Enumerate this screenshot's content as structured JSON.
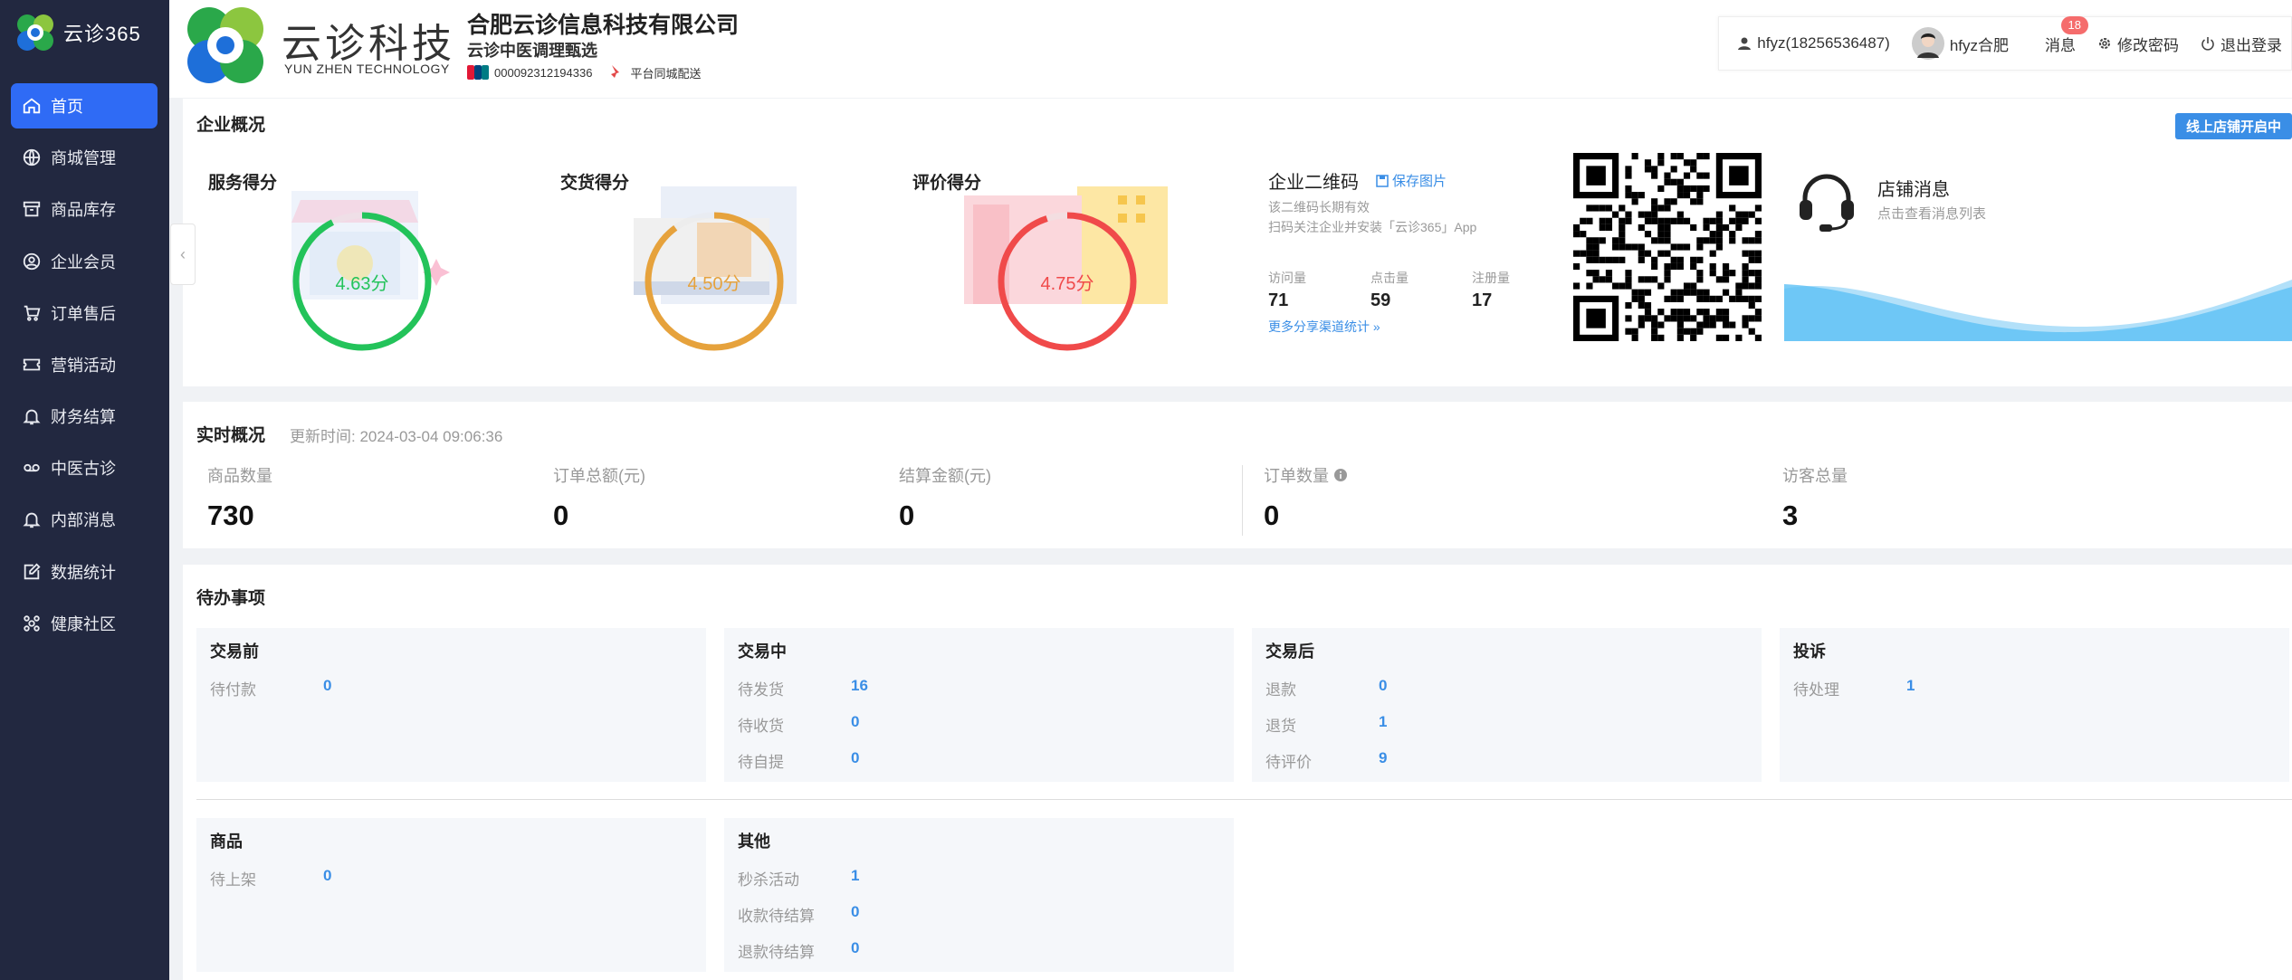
{
  "sidebar": {
    "logo": "云诊365",
    "items": [
      {
        "label": "首页",
        "icon": "home-icon"
      },
      {
        "label": "商城管理",
        "icon": "globe-icon"
      },
      {
        "label": "商品库存",
        "icon": "box-icon"
      },
      {
        "label": "企业会员",
        "icon": "user-circle-icon"
      },
      {
        "label": "订单售后",
        "icon": "cart-icon"
      },
      {
        "label": "营销活动",
        "icon": "ticket-icon"
      },
      {
        "label": "财务结算",
        "icon": "bell-icon"
      },
      {
        "label": "中医古诊",
        "icon": "voicemail-icon"
      },
      {
        "label": "内部消息",
        "icon": "bell-icon"
      },
      {
        "label": "数据统计",
        "icon": "edit-icon"
      },
      {
        "label": "健康社区",
        "icon": "community-icon"
      }
    ]
  },
  "header": {
    "brand_cn": "云诊科技",
    "brand_en": "YUN ZHEN TECHNOLOGY",
    "company": "合肥云诊信息科技有限公司",
    "slogan": "云诊中医调理甄选",
    "account": "000092312194336",
    "delivery": "平台同城配送",
    "user": "hfyz(18256536487)",
    "store": "hfyz合肥",
    "messages": "消息",
    "message_count": "18",
    "change_password": "修改密码",
    "logout": "退出登录"
  },
  "overview": {
    "title": "企业概况",
    "open_button": "线上店铺开启中",
    "scores": [
      {
        "label": "服务得分",
        "value": "4.63分",
        "score": 4.63,
        "color": "#23c35a"
      },
      {
        "label": "交货得分",
        "value": "4.50分",
        "score": 4.5,
        "color": "#e6a23c"
      },
      {
        "label": "评价得分",
        "value": "4.75分",
        "score": 4.75,
        "color": "#f04a4a"
      }
    ],
    "qr_title": "企业二维码",
    "save_image": "保存图片",
    "qr_note1": "该二维码长期有效",
    "qr_note2": "扫码关注企业并安装「云诊365」App",
    "stats": [
      {
        "label": "访问量",
        "value": "71"
      },
      {
        "label": "点击量",
        "value": "59"
      },
      {
        "label": "注册量",
        "value": "17"
      }
    ],
    "more_link": "更多分享渠道统计 »",
    "shop_msg_title": "店铺消息",
    "shop_msg_sub": "点击查看消息列表"
  },
  "realtime": {
    "title": "实时概况",
    "update_label": "更新时间:",
    "update_time": "2024-03-04 09:06:36",
    "items": [
      {
        "label": "商品数量",
        "value": "730"
      },
      {
        "label": "订单总额(元)",
        "value": "0"
      },
      {
        "label": "结算金额(元)",
        "value": "0"
      },
      {
        "label": "订单数量",
        "value": "0"
      },
      {
        "label": "访客总量",
        "value": "3"
      }
    ]
  },
  "todo": {
    "title": "待办事项",
    "groups": [
      {
        "title": "交易前",
        "rows": [
          {
            "label": "待付款",
            "value": "0"
          }
        ]
      },
      {
        "title": "交易中",
        "rows": [
          {
            "label": "待发货",
            "value": "16"
          },
          {
            "label": "待收货",
            "value": "0"
          },
          {
            "label": "待自提",
            "value": "0"
          }
        ]
      },
      {
        "title": "交易后",
        "rows": [
          {
            "label": "退款",
            "value": "0"
          },
          {
            "label": "退货",
            "value": "1"
          },
          {
            "label": "待评价",
            "value": "9"
          }
        ]
      },
      {
        "title": "投诉",
        "rows": [
          {
            "label": "待处理",
            "value": "1"
          }
        ]
      },
      {
        "title": "商品",
        "rows": [
          {
            "label": "待上架",
            "value": "0"
          }
        ]
      },
      {
        "title": "其他",
        "rows": [
          {
            "label": "秒杀活动",
            "value": "1"
          },
          {
            "label": "收款待结算",
            "value": "0"
          },
          {
            "label": "退款待结算",
            "value": "0"
          }
        ]
      }
    ]
  }
}
